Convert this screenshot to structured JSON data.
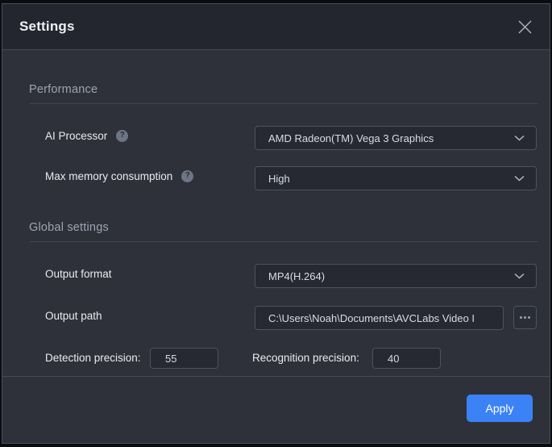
{
  "window": {
    "title": "Settings",
    "close_icon": "close-icon"
  },
  "sections": {
    "performance": {
      "title": "Performance",
      "rows": [
        {
          "label": "AI Processor",
          "help_icon": "?",
          "control": "dropdown",
          "value": "AMD Radeon(TM) Vega 3 Graphics"
        },
        {
          "label": "Max memory consumption",
          "help_icon": "?",
          "control": "dropdown",
          "value": "High"
        }
      ]
    },
    "global": {
      "title": "Global settings",
      "rows": [
        {
          "label": "Output format",
          "control": "dropdown",
          "value": "MP4(H.264)"
        },
        {
          "label": "Output path",
          "control": "text",
          "value": "C:\\Users\\Noah\\Documents\\AVCLabs Video I",
          "browse_label": "browse-ellipsis"
        }
      ],
      "precision": {
        "detection_label": "Detection precision:",
        "detection_value": "55",
        "recognition_label": "Recognition precision:",
        "recognition_value": "40"
      }
    }
  },
  "footer": {
    "apply_label": "Apply"
  },
  "colors": {
    "accent": "#3b82f6",
    "window_bg": "#2e313a",
    "titlebar_bg": "#23262e",
    "field_bg": "#262932",
    "field_border": "#4d525e",
    "text_primary": "#e9ebef",
    "text_muted": "#9ea4b0"
  }
}
